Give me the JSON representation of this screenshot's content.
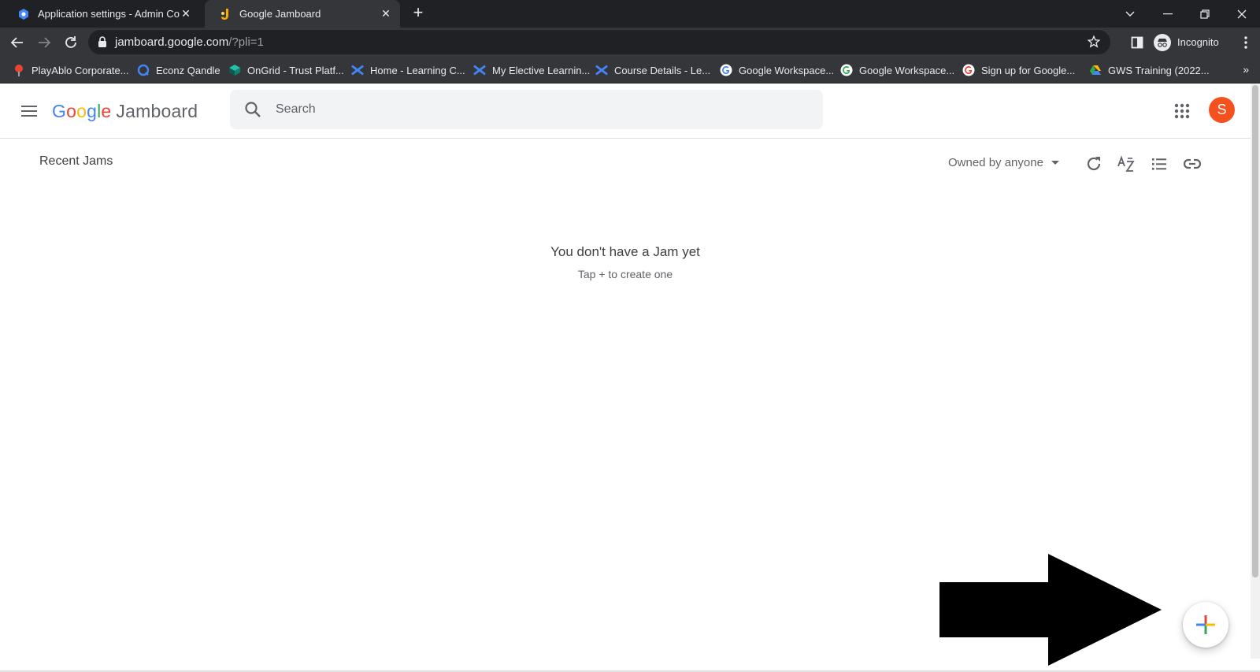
{
  "browser": {
    "tabs": [
      {
        "title": "Application settings - Admin Con",
        "active": false,
        "favicon": "admin-console-icon"
      },
      {
        "title": "Google Jamboard",
        "active": true,
        "favicon": "jamboard-icon"
      }
    ],
    "address": {
      "host": "jamboard.google.com",
      "path": "/?pli=1"
    },
    "profile_label": "Incognito",
    "bookmarks": [
      {
        "label": "PlayAblo Corporate...",
        "icon": "playablo-icon"
      },
      {
        "label": "Econz Qandle",
        "icon": "qandle-icon"
      },
      {
        "label": "OnGrid - Trust Platf...",
        "icon": "ongrid-icon"
      },
      {
        "label": "Home - Learning C...",
        "icon": "learning-x-icon"
      },
      {
        "label": "My Elective Learnin...",
        "icon": "learning-x-icon"
      },
      {
        "label": "Course Details - Le...",
        "icon": "learning-x-icon"
      },
      {
        "label": "Google Workspace...",
        "icon": "google-g-icon"
      },
      {
        "label": "Google Workspace...",
        "icon": "google-g-icon"
      },
      {
        "label": "Sign up for Google...",
        "icon": "google-g-icon"
      },
      {
        "label": "GWS Training (2022...",
        "icon": "google-drive-icon"
      }
    ]
  },
  "app": {
    "logo_brand": "Google",
    "logo_product": "Jamboard",
    "search_placeholder": "Search",
    "avatar_initial": "S",
    "avatar_color": "#f4511e"
  },
  "content": {
    "section_title": "Recent Jams",
    "owner_filter": "Owned by anyone",
    "empty_title": "You don't have a Jam yet",
    "empty_subtitle": "Tap + to create one"
  },
  "colors": {
    "tab_strip": "#202124",
    "toolbar": "#35363a",
    "google_blue": "#4285f4",
    "google_red": "#ea4335",
    "google_yellow": "#fbbc05",
    "google_green": "#34a853"
  }
}
